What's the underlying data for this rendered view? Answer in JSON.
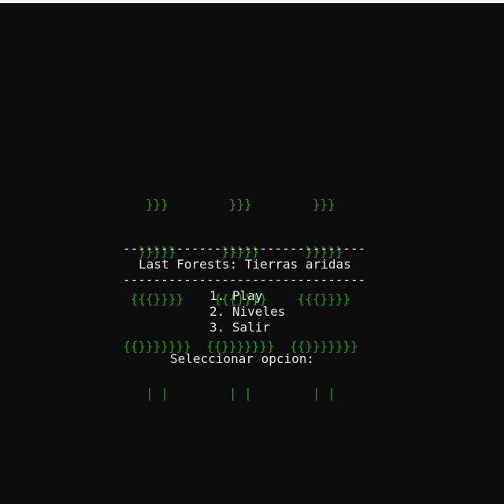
{
  "art": {
    "trees": [
      "   }}}        }}}        }}}",
      "  }}}}}      }}}}}      }}}}}",
      " {{{}}}}    {{{}}}}    {{{}}}}",
      "{{}}}}}}}  {{}}}}}}}  {{}}}}}}}",
      "   | |        | |        | |"
    ]
  },
  "divider": "--------------------------------",
  "title": "Last Forests: Tierras aridas",
  "menu": {
    "items": [
      {
        "label": "1. Play"
      },
      {
        "label": "2. Niveles"
      },
      {
        "label": "3. Salir"
      }
    ]
  },
  "prompt": "Seleccionar opcion:",
  "colors": {
    "background": "#0c0c0c",
    "tree_green": "#13a10e",
    "text": "#e6e6e6"
  }
}
